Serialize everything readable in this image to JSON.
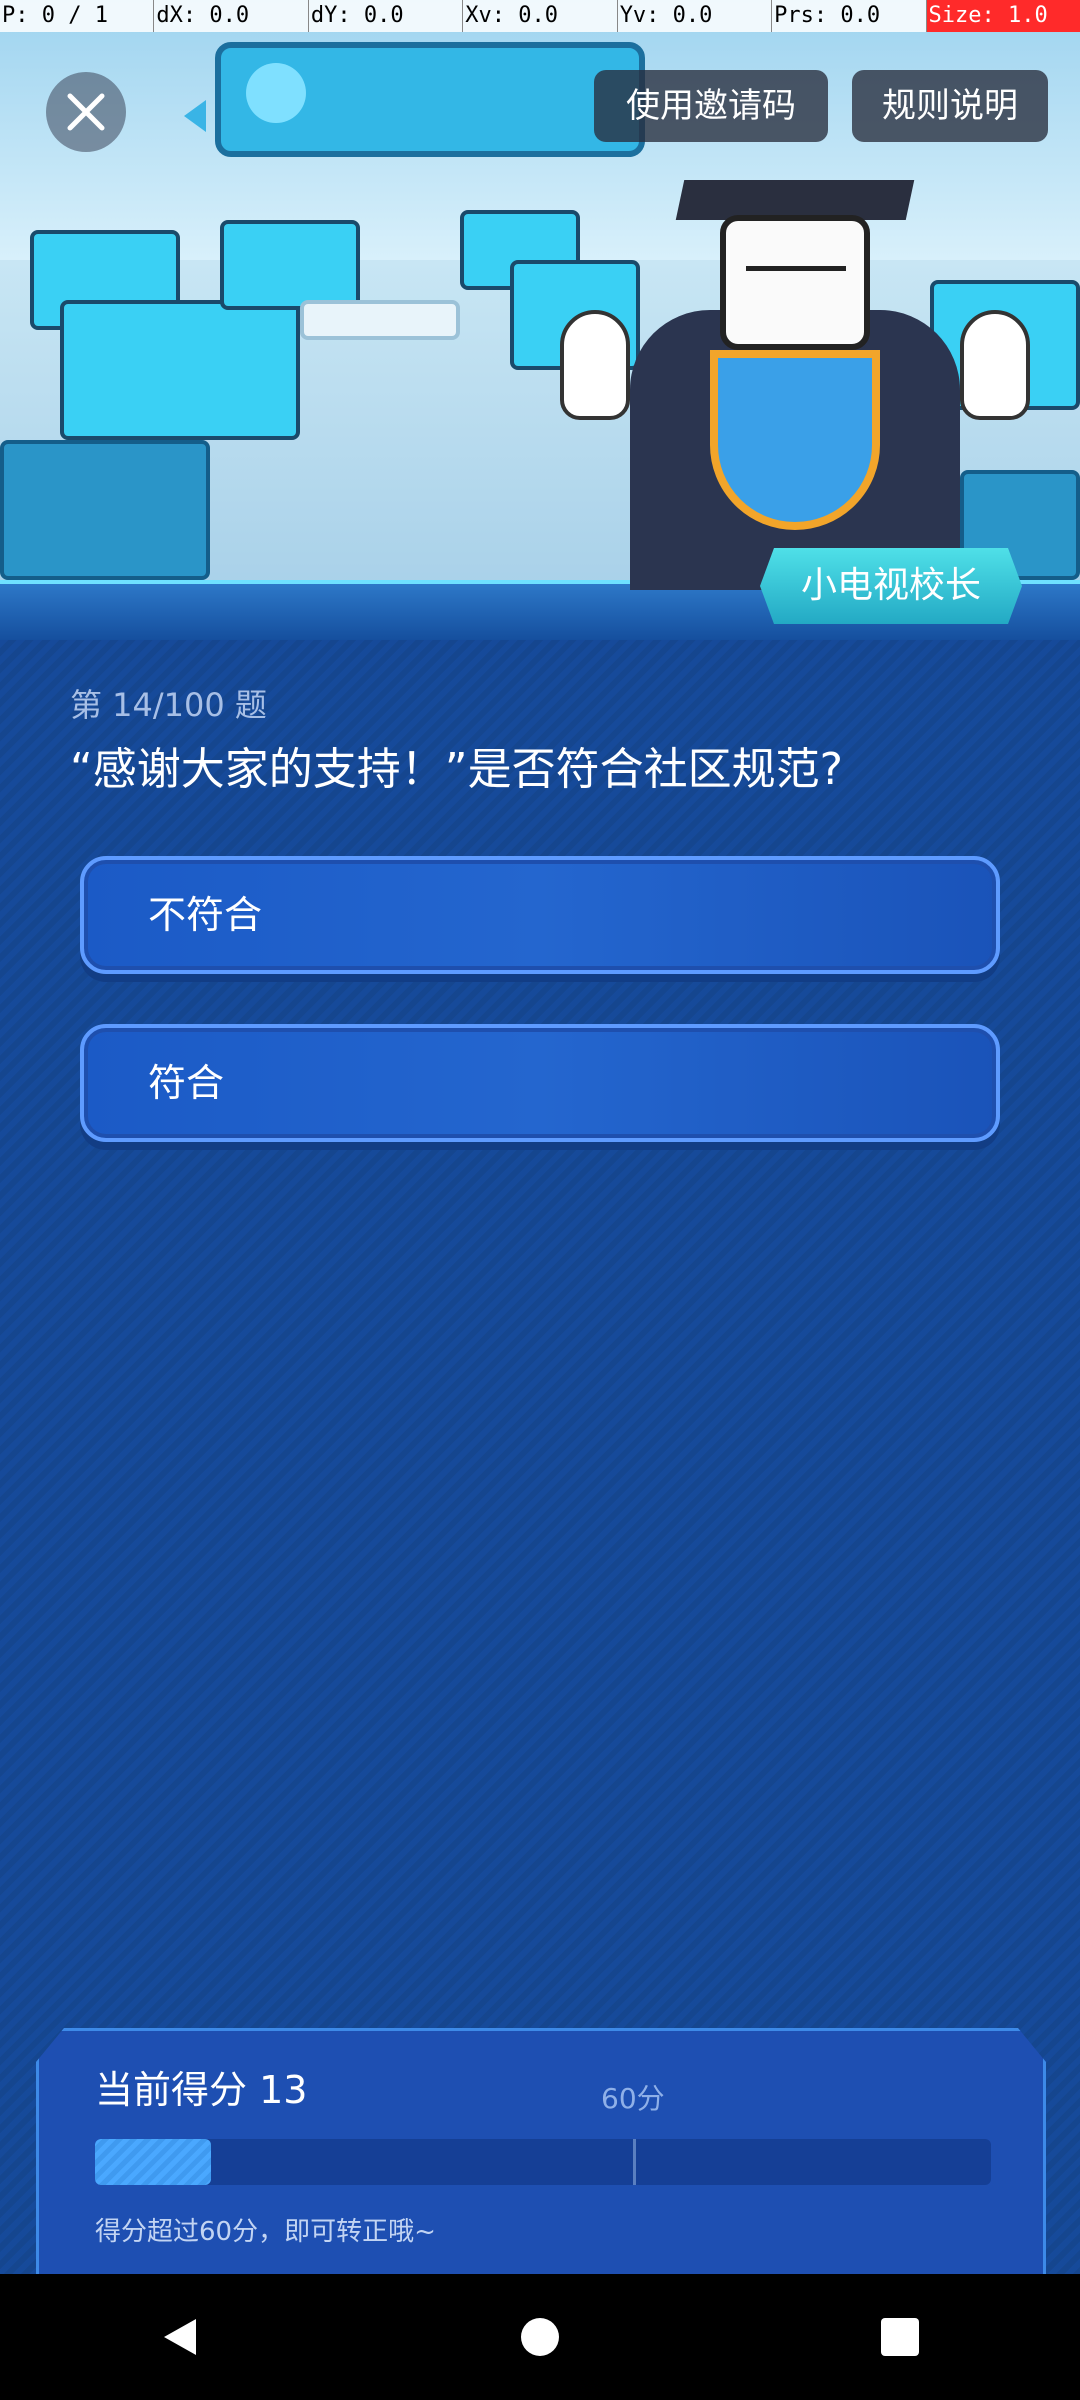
{
  "debug": {
    "p": "P: 0 / 1",
    "dx": "dX: 0.0",
    "dy": "dY: 0.0",
    "xv": "Xv: 0.0",
    "yv": "Yv: 0.0",
    "prs": "Prs: 0.0",
    "size": "Size: 1.0"
  },
  "header": {
    "invite_label": "使用邀请码",
    "rules_label": "规则说明",
    "principal_label": "小电视校长"
  },
  "quiz": {
    "counter": "第 14/100 题",
    "question": "“感谢大家的支持！”是否符合社区规范?",
    "options": [
      {
        "label": "不符合"
      },
      {
        "label": "符合"
      }
    ]
  },
  "score": {
    "label": "当前得分 13",
    "current": 13,
    "max": 100,
    "threshold": 60,
    "threshold_label": "60分",
    "hint": "得分超过60分，即可转正哦~"
  },
  "colors": {
    "background": "#164a9a",
    "accent": "#4aa8ff",
    "option_border": "#5e9bff"
  },
  "icons": {
    "close": "close-icon",
    "back": "back-icon",
    "home": "home-icon",
    "recents": "recents-icon"
  }
}
